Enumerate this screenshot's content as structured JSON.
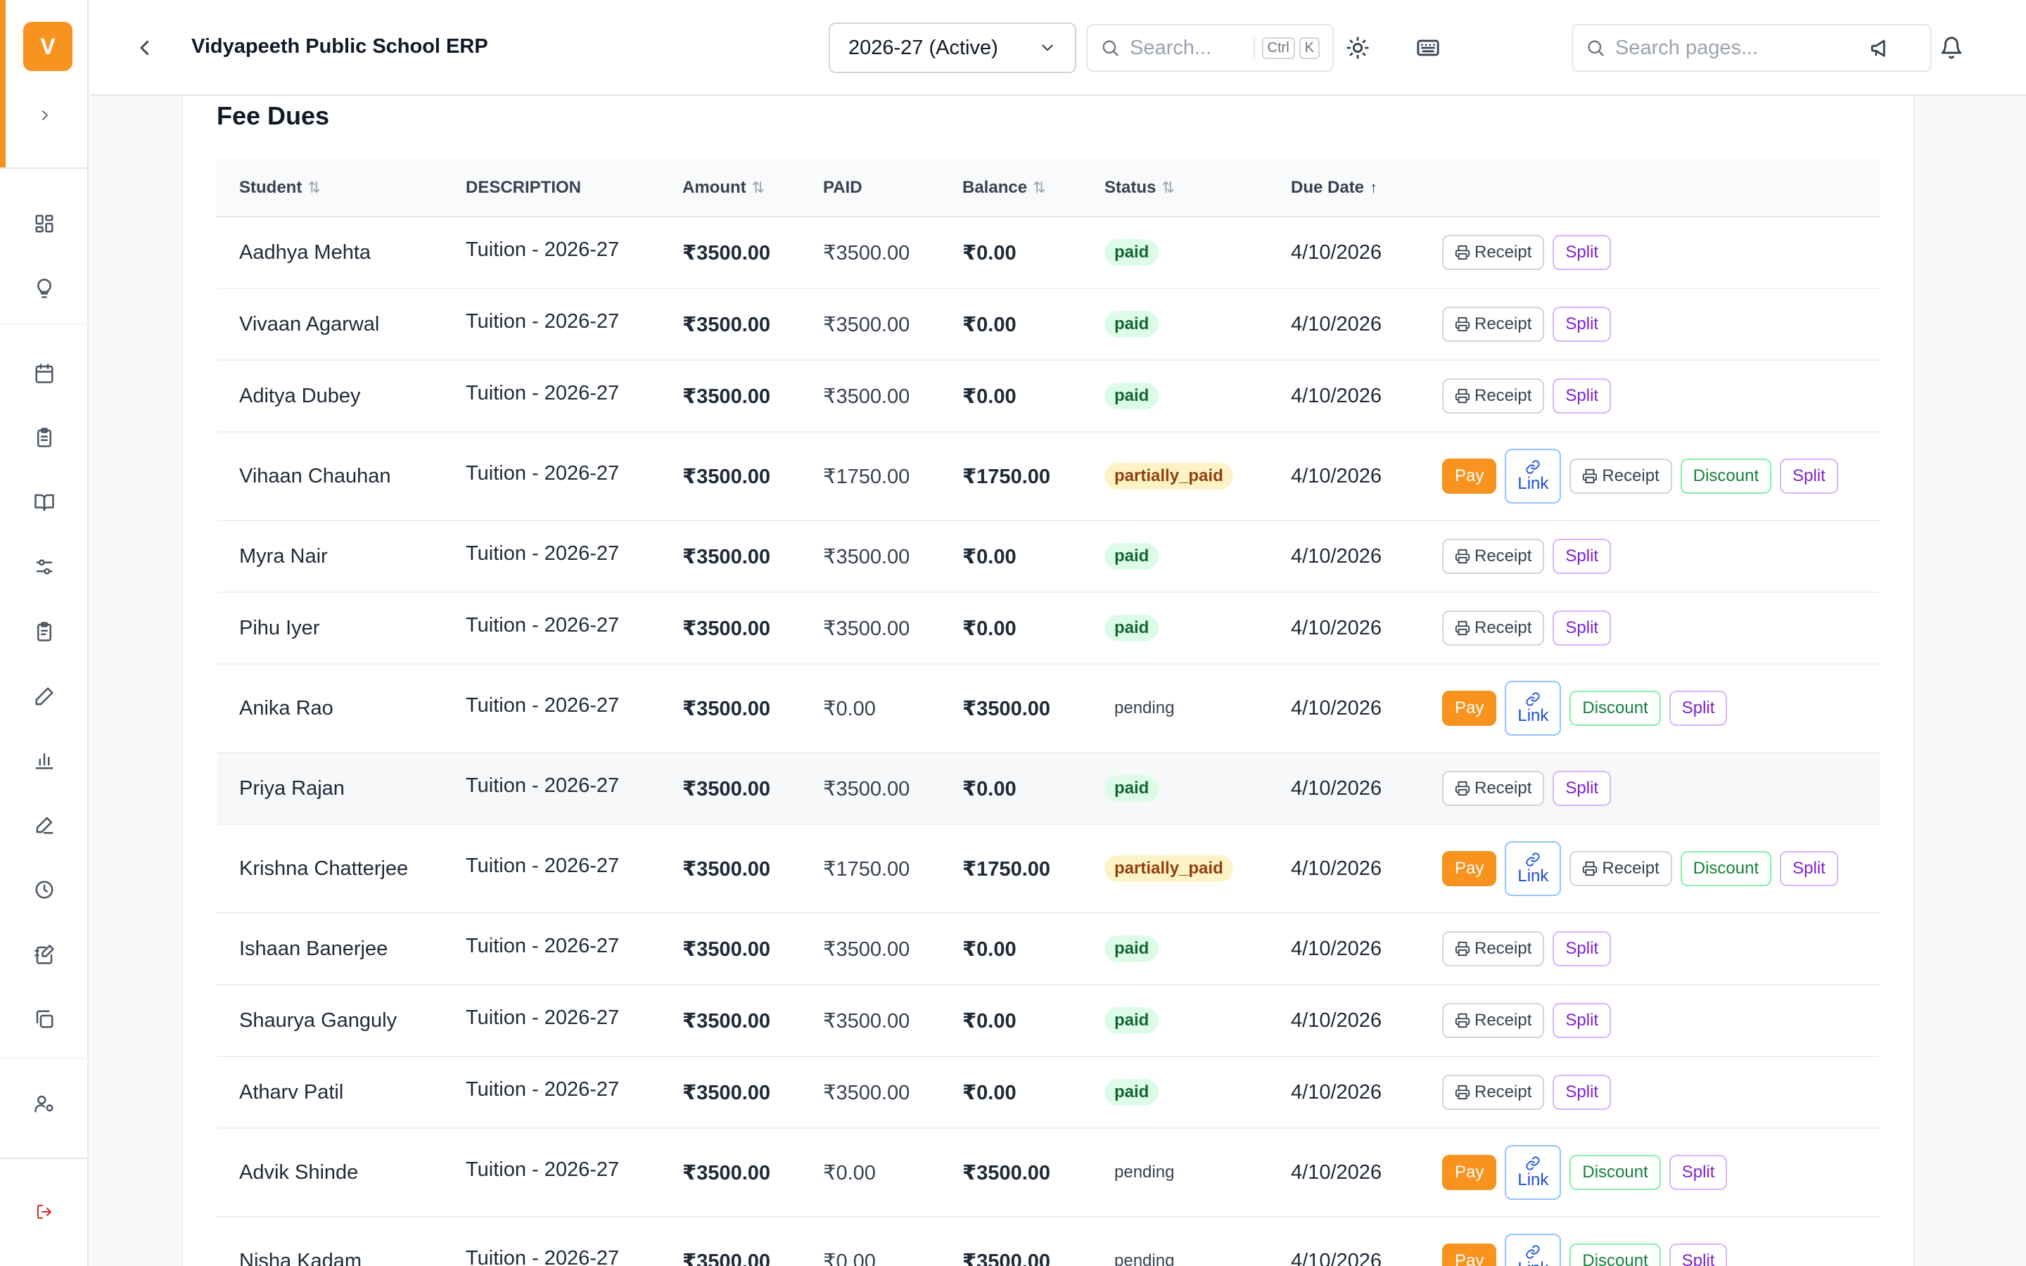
{
  "app": {
    "logo_letter": "V",
    "title": "Vidyapeeth Public School ERP"
  },
  "header": {
    "year_select": "2026-27 (Active)",
    "search_placeholder": "Search...",
    "shortcut_ctrl": "Ctrl",
    "shortcut_key": "K",
    "pages_search_placeholder": "Search pages..."
  },
  "section": {
    "title": "Fee Dues"
  },
  "table": {
    "headers": {
      "student": "Student",
      "description": "DESCRIPTION",
      "amount": "Amount",
      "paid": "PAID",
      "balance": "Balance",
      "status": "Status",
      "due_date": "Due Date"
    },
    "rows": [
      {
        "student": "Aadhya Mehta",
        "description": "Tuition - 2026-27",
        "amount": "₹3500.00",
        "paid": "₹3500.00",
        "balance": "₹0.00",
        "status": "paid",
        "due_date": "4/10/2026"
      },
      {
        "student": "Vivaan Agarwal",
        "description": "Tuition - 2026-27",
        "amount": "₹3500.00",
        "paid": "₹3500.00",
        "balance": "₹0.00",
        "status": "paid",
        "due_date": "4/10/2026"
      },
      {
        "student": "Aditya Dubey",
        "description": "Tuition - 2026-27",
        "amount": "₹3500.00",
        "paid": "₹3500.00",
        "balance": "₹0.00",
        "status": "paid",
        "due_date": "4/10/2026"
      },
      {
        "student": "Vihaan Chauhan",
        "description": "Tuition - 2026-27",
        "amount": "₹3500.00",
        "paid": "₹1750.00",
        "balance": "₹1750.00",
        "status": "partially_paid",
        "due_date": "4/10/2026"
      },
      {
        "student": "Myra Nair",
        "description": "Tuition - 2026-27",
        "amount": "₹3500.00",
        "paid": "₹3500.00",
        "balance": "₹0.00",
        "status": "paid",
        "due_date": "4/10/2026"
      },
      {
        "student": "Pihu Iyer",
        "description": "Tuition - 2026-27",
        "amount": "₹3500.00",
        "paid": "₹3500.00",
        "balance": "₹0.00",
        "status": "paid",
        "due_date": "4/10/2026"
      },
      {
        "student": "Anika Rao",
        "description": "Tuition - 2026-27",
        "amount": "₹3500.00",
        "paid": "₹0.00",
        "balance": "₹3500.00",
        "status": "pending",
        "due_date": "4/10/2026"
      },
      {
        "student": "Priya Rajan",
        "description": "Tuition - 2026-27",
        "amount": "₹3500.00",
        "paid": "₹3500.00",
        "balance": "₹0.00",
        "status": "paid",
        "due_date": "4/10/2026"
      },
      {
        "student": "Krishna Chatterjee",
        "description": "Tuition - 2026-27",
        "amount": "₹3500.00",
        "paid": "₹1750.00",
        "balance": "₹1750.00",
        "status": "partially_paid",
        "due_date": "4/10/2026"
      },
      {
        "student": "Ishaan Banerjee",
        "description": "Tuition - 2026-27",
        "amount": "₹3500.00",
        "paid": "₹3500.00",
        "balance": "₹0.00",
        "status": "paid",
        "due_date": "4/10/2026"
      },
      {
        "student": "Shaurya Ganguly",
        "description": "Tuition - 2026-27",
        "amount": "₹3500.00",
        "paid": "₹3500.00",
        "balance": "₹0.00",
        "status": "paid",
        "due_date": "4/10/2026"
      },
      {
        "student": "Atharv Patil",
        "description": "Tuition - 2026-27",
        "amount": "₹3500.00",
        "paid": "₹3500.00",
        "balance": "₹0.00",
        "status": "paid",
        "due_date": "4/10/2026"
      },
      {
        "student": "Advik Shinde",
        "description": "Tuition - 2026-27",
        "amount": "₹3500.00",
        "paid": "₹0.00",
        "balance": "₹3500.00",
        "status": "pending",
        "due_date": "4/10/2026"
      },
      {
        "student": "Nisha Kadam",
        "description": "Tuition - 2026-27",
        "amount": "₹3500.00",
        "paid": "₹0.00",
        "balance": "₹3500.00",
        "status": "pending",
        "due_date": "4/10/2026"
      }
    ]
  },
  "actions": {
    "pay": "Pay",
    "link": "Link",
    "receipt": "Receipt",
    "discount": "Discount",
    "split": "Split"
  },
  "icons": {
    "sidebar": [
      "dashboard-icon",
      "lightbulb-icon",
      "calendar-icon",
      "clipboard-icon",
      "book-icon",
      "sliders-icon",
      "clipboard-list-icon",
      "pen-icon",
      "bar-chart-icon",
      "pen-line-icon",
      "clock-icon",
      "notebook-pen-icon",
      "copy-icon",
      "user-cog-icon",
      "logout-icon"
    ],
    "header": [
      "back-chevron-icon",
      "chevron-down-icon",
      "search-icon",
      "sun-icon",
      "keyboard-icon",
      "megaphone-icon",
      "bell-icon"
    ]
  },
  "colors": {
    "accent": "#f7931e",
    "paid_bg": "#dcfce7",
    "partial_bg": "#fef3c7",
    "link": "#1d4ed8",
    "discount": "#15803d",
    "split": "#7e22ce"
  }
}
